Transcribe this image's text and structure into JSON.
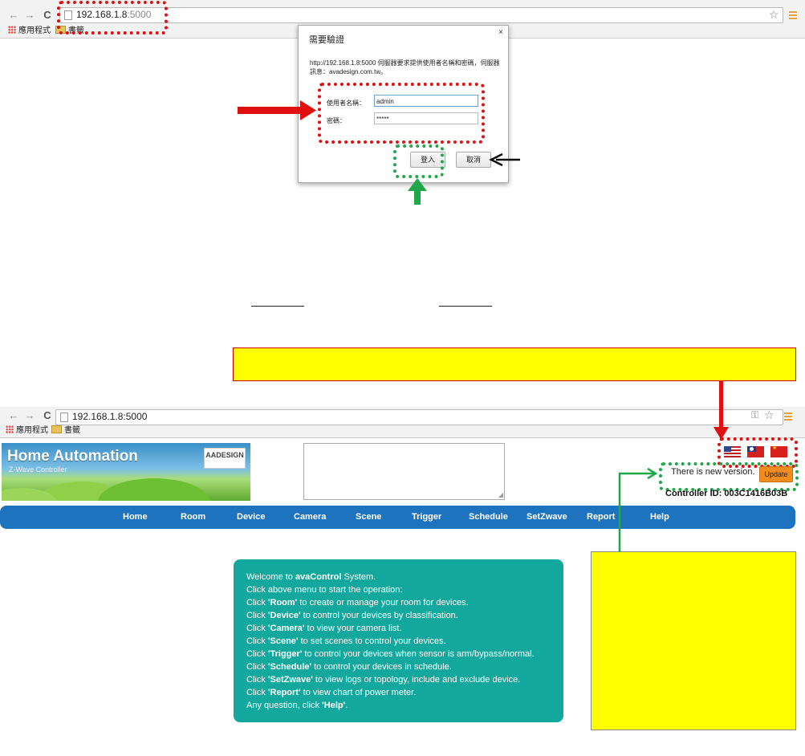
{
  "browser_top": {
    "url_host": "192.168.1.8",
    "url_port": ":5000",
    "bookmarks": [
      "應用程式",
      "書籤"
    ]
  },
  "auth_dialog": {
    "title": "需要驗證",
    "close": "×",
    "message": "http://192.168.1.8:5000 伺服器要求提供使用者名稱和密碼，伺服器訊息：avadesign.com.tw。",
    "username_label": "使用者名稱：",
    "username_value": "admin",
    "password_label": "密碼：",
    "password_value": "*****",
    "login_button": "登入",
    "cancel_button": "取消"
  },
  "browser_bottom": {
    "url": "192.168.1.8:5000",
    "bookmarks": [
      "應用程式",
      "書籤"
    ]
  },
  "app": {
    "banner_title": "Home Automation",
    "banner_subtitle": "Z-Wave Controller",
    "logo_text": "AADESIGN",
    "new_version_text": "There is new version.",
    "update_button": "Update",
    "controller_id": "Controller ID: 003C1416B03B",
    "nav": [
      "Home",
      "Room",
      "Device",
      "Camera",
      "Scene",
      "Trigger",
      "Schedule",
      "SetZwave",
      "Report",
      "Help"
    ],
    "welcome_lines": [
      [
        "Welcome to ",
        "avaControl",
        " System."
      ],
      [
        "Click above menu to start the operation:",
        "",
        ""
      ],
      [
        "Click ",
        "'Room'",
        " to create or manage your room for devices."
      ],
      [
        "Click ",
        "'Device'",
        " to control your devices by classification."
      ],
      [
        "Click ",
        "'Camera'",
        " to view your camera list."
      ],
      [
        "Click ",
        "'Scene'",
        " to set scenes to control your devices."
      ],
      [
        "Click ",
        "'Trigger'",
        " to control your devices when sensor is arm/bypass/normal."
      ],
      [
        "Click ",
        "'Schedule'",
        " to control your devices in schedule."
      ],
      [
        "Click ",
        "'SetZwave'",
        " to view logs or topology, include and exclude device."
      ],
      [
        "Click ",
        "'Report'",
        " to view chart of power meter."
      ],
      [
        "Any question, click ",
        "'Help'",
        "."
      ]
    ]
  },
  "colors": {
    "annotation_red": "#e01010",
    "annotation_green": "#1ea84a",
    "highlight_yellow": "#ffff00",
    "nav_blue": "#1e73be",
    "welcome_teal": "#13a89e",
    "update_orange": "#f08c1e"
  }
}
